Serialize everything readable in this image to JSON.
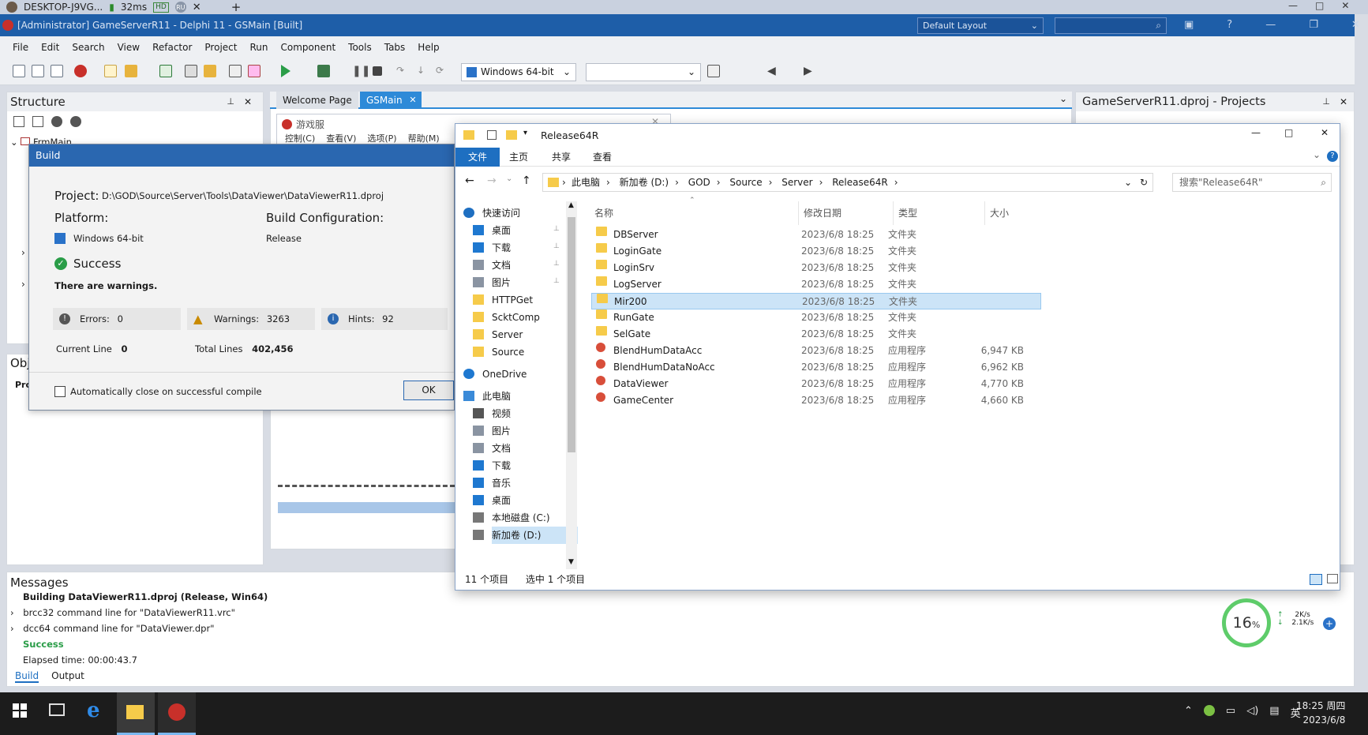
{
  "remote_bar": {
    "host": "DESKTOP-J9VG...",
    "ping": "32ms",
    "hd": "HD",
    "ru": "RU"
  },
  "ide": {
    "title": "[Administrator] GameServerR11 - Delphi 11 - GSMain [Built]",
    "layout": "Default Layout",
    "menus": [
      "File",
      "Edit",
      "Search",
      "View",
      "Refactor",
      "Project",
      "Run",
      "Component",
      "Tools",
      "Tabs",
      "Help"
    ],
    "platform": "Windows 64-bit",
    "structure_title": "Structure",
    "structure_item": "FrmMain",
    "obj_title": "Obj",
    "obj_sub": "Pro",
    "tabs": [
      "Welcome Page",
      "GSMain"
    ],
    "form_caption": "游戏服",
    "form_menu": [
      "控制(C)",
      "查看(V)",
      "选项(P)",
      "帮助(M)"
    ],
    "projects_title": "GameServerR11.dproj - Projects"
  },
  "build": {
    "title": "Build",
    "project_label": "Project:",
    "project_path": "D:\\GOD\\Source\\Server\\Tools\\DataViewer\\DataViewerR11.dproj",
    "platform_label": "Platform:",
    "platform_value": "Windows 64-bit",
    "config_label": "Build Configuration:",
    "config_value": "Release",
    "status": "Success",
    "warning_note": "There are warnings.",
    "errors_label": "Errors:",
    "errors": "0",
    "warnings_label": "Warnings:",
    "warnings": "3263",
    "hints_label": "Hints:",
    "hints": "92",
    "current_line_label": "Current Line",
    "current_line": "0",
    "total_lines_label": "Total Lines",
    "total_lines": "402,456",
    "auto_close": "Automatically close on successful compile",
    "ok": "OK"
  },
  "explorer": {
    "title": "Release64R",
    "ribbon": [
      "文件",
      "主页",
      "共享",
      "查看"
    ],
    "path": [
      "此电脑",
      "新加卷 (D:)",
      "GOD",
      "Source",
      "Server",
      "Release64R"
    ],
    "search_placeholder": "搜索\"Release64R\"",
    "nav": [
      {
        "label": "快速访问",
        "icon": "star-icon"
      },
      {
        "label": "桌面",
        "icon": "desktop-icon",
        "pin": true
      },
      {
        "label": "下载",
        "icon": "download-icon",
        "pin": true
      },
      {
        "label": "文档",
        "icon": "document-icon",
        "pin": true
      },
      {
        "label": "图片",
        "icon": "picture-icon",
        "pin": true
      },
      {
        "label": "HTTPGet",
        "icon": "folder-icon"
      },
      {
        "label": "ScktComp",
        "icon": "folder-icon"
      },
      {
        "label": "Server",
        "icon": "folder-icon"
      },
      {
        "label": "Source",
        "icon": "folder-icon"
      },
      {
        "label": "OneDrive",
        "icon": "cloud-icon"
      },
      {
        "label": "此电脑",
        "icon": "computer-icon"
      },
      {
        "label": "视频",
        "icon": "video-icon"
      },
      {
        "label": "图片",
        "icon": "picture-icon"
      },
      {
        "label": "文档",
        "icon": "document-icon"
      },
      {
        "label": "下载",
        "icon": "download-icon"
      },
      {
        "label": "音乐",
        "icon": "music-icon"
      },
      {
        "label": "桌面",
        "icon": "desktop-icon"
      },
      {
        "label": "本地磁盘 (C:)",
        "icon": "drive-icon"
      },
      {
        "label": "新加卷 (D:)",
        "icon": "drive-icon"
      }
    ],
    "columns": [
      "名称",
      "修改日期",
      "类型",
      "大小"
    ],
    "files": [
      {
        "name": "DBServer",
        "date": "2023/6/8 18:25",
        "type": "文件夹",
        "size": "",
        "kind": "folder"
      },
      {
        "name": "LoginGate",
        "date": "2023/6/8 18:25",
        "type": "文件夹",
        "size": "",
        "kind": "folder"
      },
      {
        "name": "LoginSrv",
        "date": "2023/6/8 18:25",
        "type": "文件夹",
        "size": "",
        "kind": "folder"
      },
      {
        "name": "LogServer",
        "date": "2023/6/8 18:25",
        "type": "文件夹",
        "size": "",
        "kind": "folder"
      },
      {
        "name": "Mir200",
        "date": "2023/6/8 18:25",
        "type": "文件夹",
        "size": "",
        "kind": "folder",
        "selected": true
      },
      {
        "name": "RunGate",
        "date": "2023/6/8 18:25",
        "type": "文件夹",
        "size": "",
        "kind": "folder"
      },
      {
        "name": "SelGate",
        "date": "2023/6/8 18:25",
        "type": "文件夹",
        "size": "",
        "kind": "folder"
      },
      {
        "name": "BlendHumDataAcc",
        "date": "2023/6/8 18:25",
        "type": "应用程序",
        "size": "6,947 KB",
        "kind": "app"
      },
      {
        "name": "BlendHumDataNoAcc",
        "date": "2023/6/8 18:25",
        "type": "应用程序",
        "size": "6,962 KB",
        "kind": "app"
      },
      {
        "name": "DataViewer",
        "date": "2023/6/8 18:25",
        "type": "应用程序",
        "size": "4,770 KB",
        "kind": "app"
      },
      {
        "name": "GameCenter",
        "date": "2023/6/8 18:25",
        "type": "应用程序",
        "size": "4,660 KB",
        "kind": "app"
      }
    ],
    "status_count": "11 个项目",
    "status_selected": "选中 1 个项目"
  },
  "messages": {
    "title": "Messages",
    "lines": [
      "Building DataViewerR11.dproj (Release, Win64)",
      "brcc32 command line for \"DataViewerR11.vrc\"",
      "dcc64 command line for \"DataViewer.dpr\"",
      "Success",
      "Elapsed time: 00:00:43.7"
    ],
    "tabs": [
      "Build",
      "Output"
    ]
  },
  "net_widget": {
    "percent": "16",
    "unit": "%",
    "up": "2K/s",
    "down": "2.1K/s"
  },
  "taskbar": {
    "time": "18:25 周四",
    "date": "2023/6/8",
    "ime": "英"
  },
  "colors": {
    "accent": "#2a67b0",
    "ide_title": "#1e5ea8",
    "selection": "#cce4f7",
    "explorer_tab": "#1e6fc1",
    "success": "#2a9d48"
  }
}
